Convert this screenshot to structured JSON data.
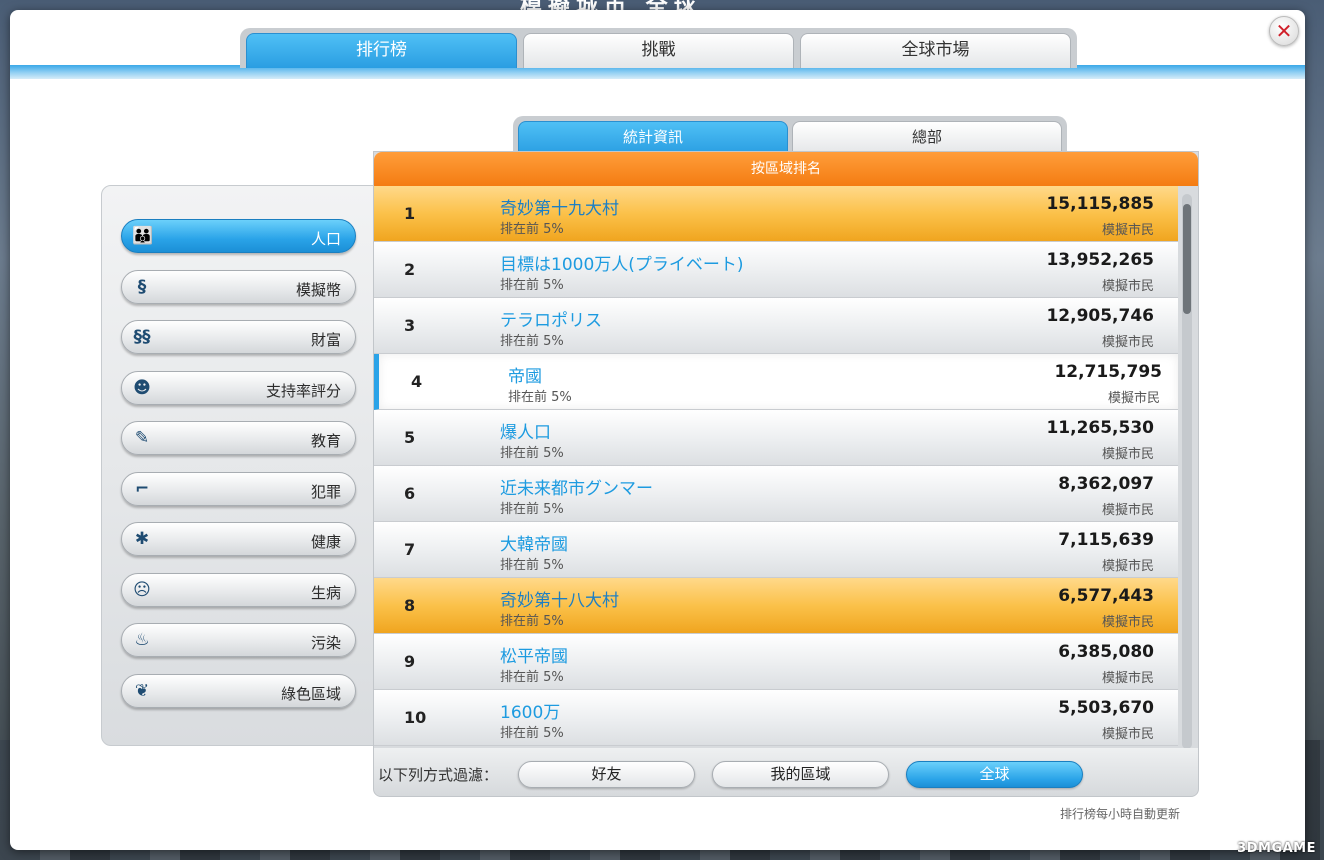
{
  "bg_title": "模擬城市 全球",
  "close_glyph": "✕",
  "top_tabs": [
    {
      "label": "排行榜",
      "active": true
    },
    {
      "label": "挑戰",
      "active": false
    },
    {
      "label": "全球市場",
      "active": false
    }
  ],
  "sub_tabs": [
    {
      "label": "統計資訊",
      "active": true
    },
    {
      "label": "總部",
      "active": false
    }
  ],
  "categories": [
    {
      "label": "人口",
      "icon": "population-icon",
      "glyph": "👪",
      "active": true
    },
    {
      "label": "模擬幣",
      "icon": "simoleon-icon",
      "glyph": "§",
      "active": false
    },
    {
      "label": "財富",
      "icon": "wealth-icon",
      "glyph": "§§",
      "active": false
    },
    {
      "label": "支持率評分",
      "icon": "approval-smiley-icon",
      "glyph": "☻",
      "active": false
    },
    {
      "label": "教育",
      "icon": "education-book-icon",
      "glyph": "✎",
      "active": false
    },
    {
      "label": "犯罪",
      "icon": "crime-gun-icon",
      "glyph": "⌐",
      "active": false
    },
    {
      "label": "健康",
      "icon": "health-star-of-life-icon",
      "glyph": "✱",
      "active": false
    },
    {
      "label": "生病",
      "icon": "sick-face-icon",
      "glyph": "☹",
      "active": false
    },
    {
      "label": "污染",
      "icon": "pollution-smokestack-icon",
      "glyph": "♨",
      "active": false
    },
    {
      "label": "綠色區域",
      "icon": "green-leaf-icon",
      "glyph": "❦",
      "active": false
    }
  ],
  "list_header": "按區域排名",
  "rows": [
    {
      "rank": "1",
      "city": "奇妙第十九大村",
      "sub": "排在前 5%",
      "value": "15,115,885",
      "unit": "模擬市民",
      "style": "gold"
    },
    {
      "rank": "2",
      "city": "目標は1000万人(プライベート)",
      "sub": "排在前 5%",
      "value": "13,952,265",
      "unit": "模擬市民",
      "style": "normal"
    },
    {
      "rank": "3",
      "city": "テラロポリス",
      "sub": "排在前 5%",
      "value": "12,905,746",
      "unit": "模擬市民",
      "style": "normal"
    },
    {
      "rank": "4",
      "city": "帝國",
      "sub": "排在前 5%",
      "value": "12,715,795",
      "unit": "模擬市民",
      "style": "selected"
    },
    {
      "rank": "5",
      "city": "爆人口",
      "sub": "排在前 5%",
      "value": "11,265,530",
      "unit": "模擬市民",
      "style": "normal"
    },
    {
      "rank": "6",
      "city": "近未来都市グンマー",
      "sub": "排在前 5%",
      "value": "8,362,097",
      "unit": "模擬市民",
      "style": "normal"
    },
    {
      "rank": "7",
      "city": "大韓帝國",
      "sub": "排在前 5%",
      "value": "7,115,639",
      "unit": "模擬市民",
      "style": "normal"
    },
    {
      "rank": "8",
      "city": "奇妙第十八大村",
      "sub": "排在前 5%",
      "value": "6,577,443",
      "unit": "模擬市民",
      "style": "gold"
    },
    {
      "rank": "9",
      "city": "松平帝國",
      "sub": "排在前 5%",
      "value": "6,385,080",
      "unit": "模擬市民",
      "style": "normal"
    },
    {
      "rank": "10",
      "city": "1600万",
      "sub": "排在前 5%",
      "value": "5,503,670",
      "unit": "模擬市民",
      "style": "normal"
    }
  ],
  "filter": {
    "label": "以下列方式過濾：",
    "options": [
      {
        "label": "好友",
        "active": false
      },
      {
        "label": "我的區域",
        "active": false
      },
      {
        "label": "全球",
        "active": true
      }
    ]
  },
  "footer_note": "排行榜每小時自動更新",
  "watermark": "3DMGAME",
  "colors": {
    "accent_blue": "#2aa3e8",
    "header_orange": "#f47c12",
    "gold_row": "#fbc14a",
    "city_link": "#1d9be0",
    "close_red": "#d0202a"
  }
}
